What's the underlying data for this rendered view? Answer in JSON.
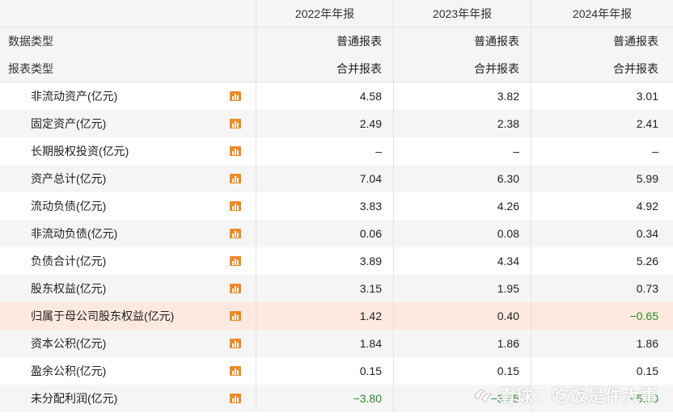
{
  "header": {
    "col1": "2022年年报",
    "col2": "2023年年报",
    "col3": "2024年年报"
  },
  "meta_rows": [
    {
      "label": "数据类型",
      "values": [
        "普通报表",
        "普通报表",
        "普通报表"
      ]
    },
    {
      "label": "报表类型",
      "values": [
        "合并报表",
        "合并报表",
        "合并报表"
      ]
    }
  ],
  "rows": [
    {
      "label": "非流动资产(亿元)",
      "values": [
        "4.58",
        "3.82",
        "3.01"
      ],
      "icon": "bar-chart-icon"
    },
    {
      "label": "固定资产(亿元)",
      "values": [
        "2.49",
        "2.38",
        "2.41"
      ],
      "icon": "bar-chart-icon"
    },
    {
      "label": "长期股权投资(亿元)",
      "values": [
        "–",
        "–",
        "–"
      ],
      "icon": "bar-chart-icon"
    },
    {
      "label": "资产总计(亿元)",
      "values": [
        "7.04",
        "6.30",
        "5.99"
      ],
      "icon": "bar-chart-icon"
    },
    {
      "label": "流动负债(亿元)",
      "values": [
        "3.83",
        "4.26",
        "4.92"
      ],
      "icon": "bar-chart-icon"
    },
    {
      "label": "非流动负债(亿元)",
      "values": [
        "0.06",
        "0.08",
        "0.34"
      ],
      "icon": "bar-chart-icon"
    },
    {
      "label": "负债合计(亿元)",
      "values": [
        "3.89",
        "4.34",
        "5.26"
      ],
      "icon": "bar-chart-icon"
    },
    {
      "label": "股东权益(亿元)",
      "values": [
        "3.15",
        "1.95",
        "0.73"
      ],
      "icon": "bar-chart-icon"
    },
    {
      "label": "归属于母公司股东权益(亿元)",
      "values": [
        "1.42",
        "0.40",
        "−0.65"
      ],
      "icon": "bar-chart-icon"
    },
    {
      "label": "资本公积(亿元)",
      "values": [
        "1.84",
        "1.86",
        "1.86"
      ],
      "icon": "bar-chart-icon"
    },
    {
      "label": "盈余公积(亿元)",
      "values": [
        "0.15",
        "0.15",
        "0.15"
      ],
      "icon": "bar-chart-icon"
    },
    {
      "label": "未分配利润(亿元)",
      "values": [
        "−3.80",
        "−3.85",
        "−5.90"
      ],
      "icon": "bar-chart-icon"
    }
  ],
  "watermark": "雪球：吃饭是件大事",
  "colors": {
    "negative": "#2a8a2a",
    "highlight_row": "#fde9df",
    "icon_orange": "#f08a24"
  }
}
